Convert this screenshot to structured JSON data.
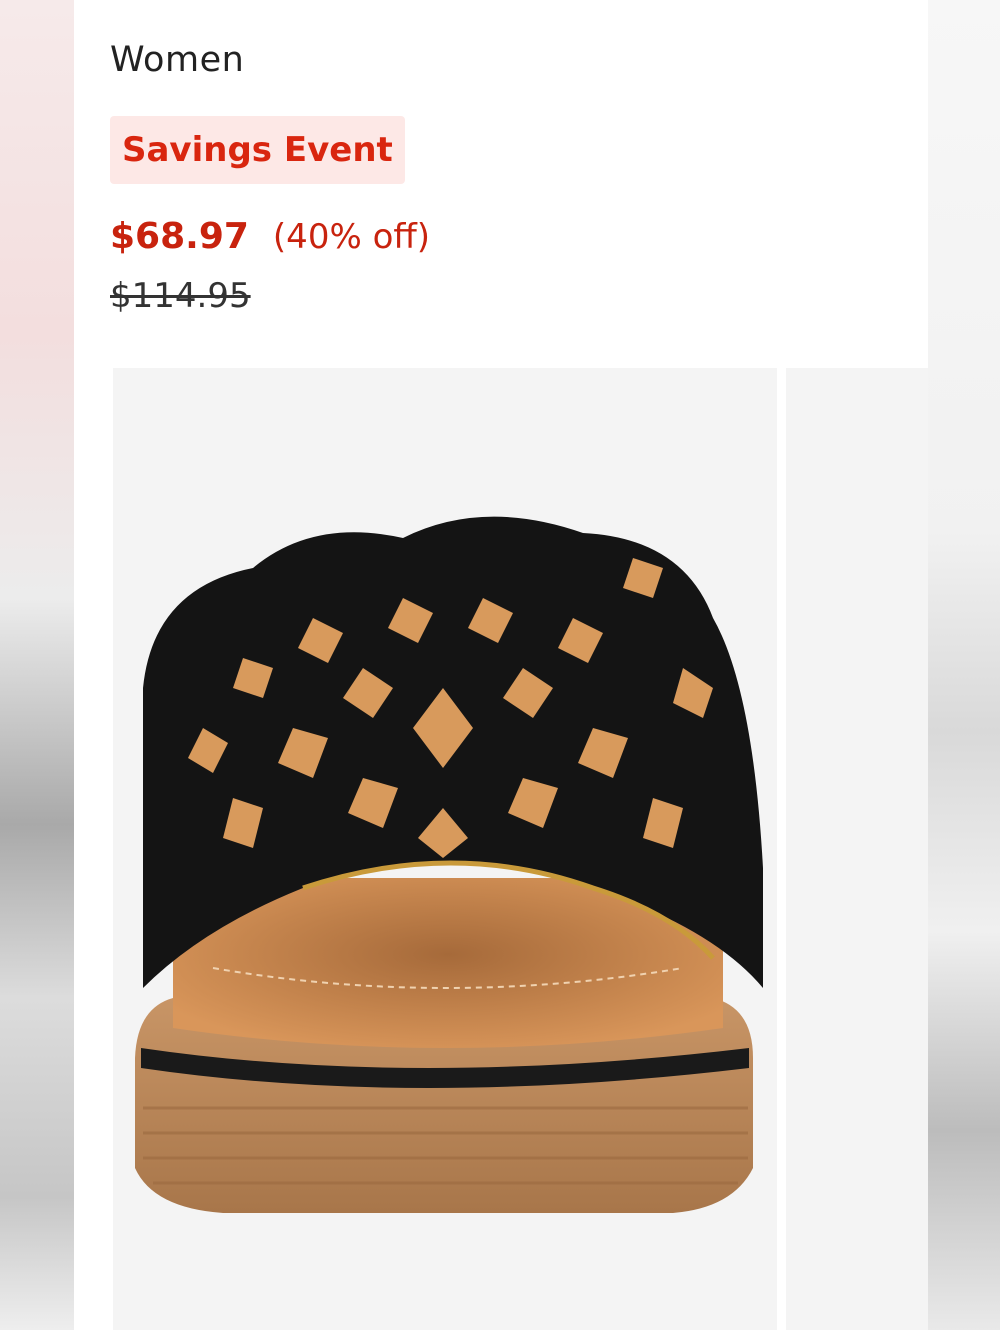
{
  "product": {
    "category": "Women",
    "badge": "Savings Event",
    "sale_price": "$68.97",
    "discount": "(40% off)",
    "original_price": "$114.95"
  },
  "gallery": {
    "current_image": "black-cutout-slide-sandal",
    "next_image_visible": true
  },
  "colors": {
    "sale_red": "#c8230e",
    "badge_bg": "#fde8e6",
    "badge_text": "#d9260f"
  }
}
